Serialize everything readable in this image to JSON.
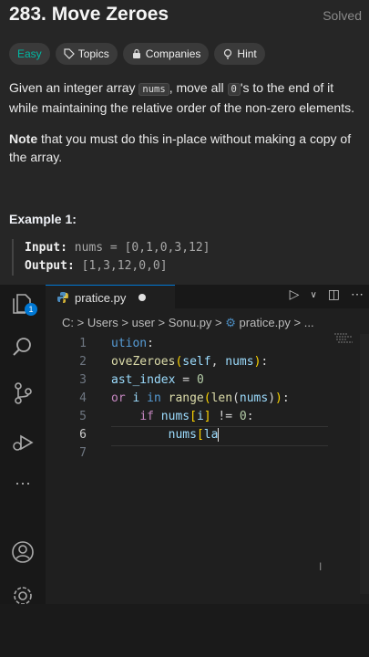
{
  "problem": {
    "title": "283. Move Zeroes",
    "status": "Solved",
    "tags": [
      "Easy",
      "Topics",
      "Companies",
      "Hint"
    ],
    "desc_before": "Given an integer array ",
    "desc_code": "nums",
    "desc_mid": ", move all ",
    "desc_code2": "0",
    "desc_after": "'s to the end of it while maintaining the relative order of the non-zero elements.",
    "note_bold": "Note",
    "note_rest": " that you must do this in-place without making a copy of the array.",
    "example_title": "Example 1:",
    "input_label": "Input:",
    "input_value": "nums = [0,1,0,3,12]",
    "output_label": "Output:",
    "output_value": "[1,3,12,0,0]"
  },
  "editor": {
    "tab_label": "pratice.py",
    "badge_count": "1",
    "breadcrumb": [
      "C:",
      "Users",
      "user",
      "Sonu.py",
      "pratice.py",
      "..."
    ],
    "line_numbers": [
      "1",
      "2",
      "3",
      "4",
      "5",
      "6",
      "7"
    ]
  },
  "icons": [
    "explorer-icon",
    "search-icon",
    "source-control-icon",
    "run-debug-icon",
    "more-icon",
    "account-icon",
    "settings-icon",
    "run-icon",
    "split-editor-icon",
    "more-actions-icon",
    "python-file-icon"
  ]
}
